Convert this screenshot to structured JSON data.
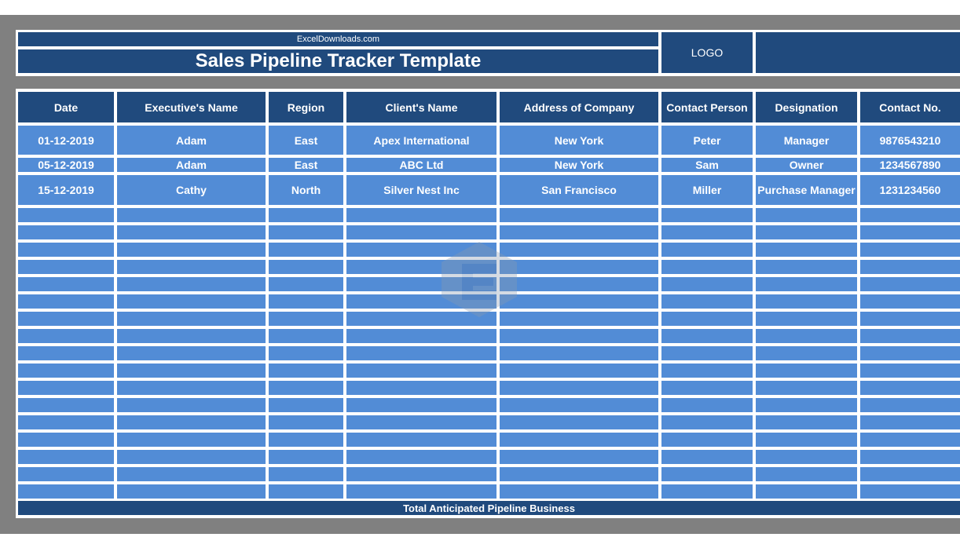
{
  "header": {
    "site": "ExcelDownloads.com",
    "title": "Sales Pipeline Tracker Template",
    "logo": "LOGO"
  },
  "table": {
    "columns": [
      "Date",
      "Executive's Name",
      "Region",
      "Client's Name",
      "Address of Company",
      "Contact Person",
      "Designation",
      "Contact No."
    ],
    "rows": [
      [
        "01-12-2019",
        "Adam",
        "East",
        "Apex International",
        "New York",
        "Peter",
        "Manager",
        "9876543210"
      ],
      [
        "05-12-2019",
        "Adam",
        "East",
        "ABC Ltd",
        "New York",
        "Sam",
        "Owner",
        "1234567890"
      ],
      [
        "15-12-2019",
        "Cathy",
        "North",
        "Silver Nest Inc",
        "San Francisco",
        "Miller",
        "Purchase Manager",
        "1231234560"
      ]
    ],
    "total_label": "Total Anticipated Pipeline Business"
  },
  "colors": {
    "dark": "#204a7d",
    "light": "#528cd6",
    "background": "#808080"
  },
  "watermark_icon": "exceldownloads-logo-icon"
}
